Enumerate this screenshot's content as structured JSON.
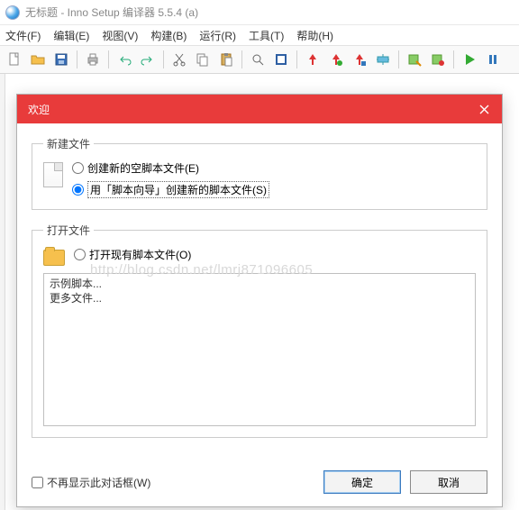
{
  "title": "无标题 - Inno Setup 编译器 5.5.4 (a)",
  "menu": {
    "file": "文件(F)",
    "edit": "编辑(E)",
    "view": "视图(V)",
    "build": "构建(B)",
    "run": "运行(R)",
    "tools": "工具(T)",
    "help": "帮助(H)"
  },
  "dialog": {
    "title": "欢迎",
    "group_new": "新建文件",
    "group_open": "打开文件",
    "radio_empty": "创建新的空脚本文件(E)",
    "radio_wizard": "用「脚本向导」创建新的脚本文件(S)",
    "radio_openexisting": "打开现有脚本文件(O)",
    "list_text": "示例脚本...\n更多文件...",
    "dont_show": "不再显示此对话框(W)",
    "ok": "确定",
    "cancel": "取消"
  },
  "watermark": "http://blog.csdn.net/lmrj871096605"
}
